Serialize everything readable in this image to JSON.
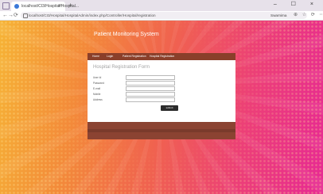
{
  "browser": {
    "tab_title": "localhost/CI3/Hospital/Hospital...",
    "tab_close": "×",
    "new_tab": "+",
    "url": "localhost/CI3/Hospital/HospitalAdmin/index.php/Controller/Hospital/registration",
    "profile_label": "Swarnima",
    "toolbar_icons": "⊕ ☆ ⟳ ⋯",
    "nav_back": "←",
    "nav_forward": "→",
    "nav_reload": "⟳",
    "window_controls": "– ☐ ×"
  },
  "site": {
    "title": "Patient Monitoring System"
  },
  "nav": {
    "items": [
      "Home",
      "Login",
      "Patient Registration",
      "Hospital Registration"
    ]
  },
  "form": {
    "title": "Hospital Registration Form",
    "fields": [
      {
        "label": "User Id",
        "value": ""
      },
      {
        "label": "Password",
        "value": ""
      },
      {
        "label": "E-mail",
        "value": ""
      },
      {
        "label": "Mobile",
        "value": ""
      },
      {
        "label": "Address",
        "value": ""
      }
    ],
    "submit_label": "submit"
  },
  "colors": {
    "nav_bg": "#8a3f2a",
    "footer_bg": "#8b4332",
    "submit_bg": "#2b2b2b"
  }
}
